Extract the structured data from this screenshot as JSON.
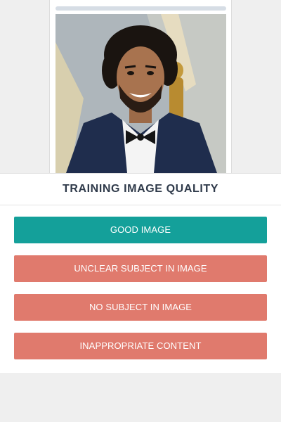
{
  "panel": {
    "title": "TRAINING IMAGE QUALITY"
  },
  "buttons": {
    "good": "GOOD IMAGE",
    "unclear": "UNCLEAR SUBJECT IN IMAGE",
    "no_subject": "NO SUBJECT IN IMAGE",
    "inappropriate": "INAPPROPRIATE CONTENT"
  },
  "colors": {
    "good": "#14a09a",
    "bad": "#e07a6d",
    "title": "#2f3a4a"
  }
}
